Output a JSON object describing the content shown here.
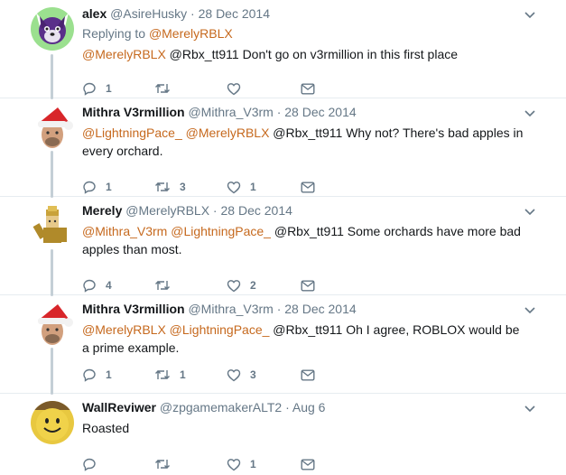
{
  "colors": {
    "link": "#c6691e",
    "muted": "#657786",
    "text": "#14171a",
    "thread_line": "#c4cfd6"
  },
  "tweets": [
    {
      "name": "alex",
      "handle": "@AsireHusky",
      "sep": " · ",
      "date": "28 Dec 2014",
      "replying_prefix": "Replying to ",
      "replying_to": "@MerelyRBLX",
      "mentions": "@MerelyRBLX",
      "body": " @Rbx_tt911 Don't go on v3rmillion in this first place",
      "reply_count": "1",
      "retweet_count": "",
      "like_count": "",
      "avatar_icon": "purple-husky-avatar"
    },
    {
      "name": "Mithra V3rmillion",
      "handle": "@Mithra_V3rm",
      "sep": " · ",
      "date": "28 Dec 2014",
      "mentions": "@LightningPace_ @MerelyRBLX",
      "body": " @Rbx_tt911 Why not? There's bad apples in every orchard.",
      "reply_count": "1",
      "retweet_count": "3",
      "like_count": "1",
      "avatar_icon": "santa-hat-avatar"
    },
    {
      "name": "Merely",
      "handle": "@MerelyRBLX",
      "sep": " · ",
      "date": "28 Dec 2014",
      "mentions": "@Mithra_V3rm @LightningPace_",
      "body": " @Rbx_tt911 Some orchards have more bad apples than most.",
      "reply_count": "4",
      "retweet_count": "",
      "like_count": "2",
      "avatar_icon": "roblox-character-avatar"
    },
    {
      "name": "Mithra V3rmillion",
      "handle": "@Mithra_V3rm",
      "sep": " · ",
      "date": "28 Dec 2014",
      "mentions": "@MerelyRBLX @LightningPace_",
      "body": " @Rbx_tt911 Oh I agree, ROBLOX would be a prime example.",
      "reply_count": "1",
      "retweet_count": "1",
      "like_count": "3",
      "avatar_icon": "santa-hat-avatar"
    },
    {
      "name": "WallReviwer",
      "handle": "@zpgamemakerALT2",
      "sep": " · ",
      "date": "Aug 6",
      "mentions": "",
      "body": "Roasted",
      "reply_count": "",
      "retweet_count": "",
      "like_count": "1",
      "avatar_icon": "yellow-smiley-avatar"
    }
  ]
}
